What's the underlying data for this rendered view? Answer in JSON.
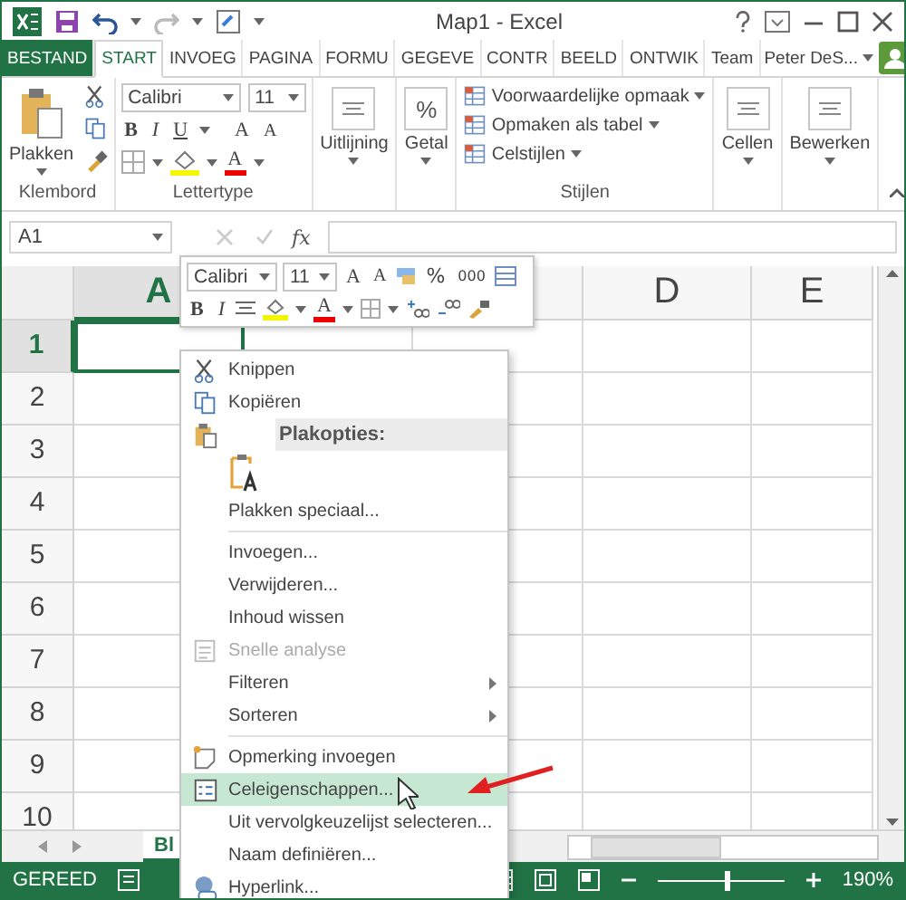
{
  "window": {
    "title": "Map1 - Excel"
  },
  "tabs": [
    {
      "label": "BESTAND",
      "kind": "file",
      "selected": false
    },
    {
      "label": "START",
      "kind": "tab",
      "selected": true
    },
    {
      "label": "INVOEG",
      "kind": "tab",
      "selected": false
    },
    {
      "label": "PAGINA",
      "kind": "tab",
      "selected": false
    },
    {
      "label": "FORMU",
      "kind": "tab",
      "selected": false
    },
    {
      "label": "GEGEVE",
      "kind": "tab",
      "selected": false
    },
    {
      "label": "CONTR",
      "kind": "tab",
      "selected": false
    },
    {
      "label": "BEELD",
      "kind": "tab",
      "selected": false
    },
    {
      "label": "ONTWIK",
      "kind": "tab",
      "selected": false
    },
    {
      "label": "Team",
      "kind": "tab",
      "selected": false
    }
  ],
  "account": {
    "name": "Peter DeS..."
  },
  "ribbon": {
    "groups": [
      {
        "kind": "clipboard",
        "name": "Klembord",
        "label": "Plakken"
      },
      {
        "kind": "font",
        "name": "Lettertype",
        "font": "Calibri",
        "size": "11",
        "bold": "B",
        "italic": "I",
        "underline": "U",
        "grow": "A",
        "shrink": "A",
        "font_color": "A"
      },
      {
        "kind": "big",
        "label": "Uitlijning"
      },
      {
        "kind": "big",
        "label": "Getal",
        "glyph": "%"
      },
      {
        "kind": "styles",
        "name": "Stijlen",
        "items": [
          "Voorwaardelijke opmaak",
          "Opmaken als tabel",
          "Celstijlen"
        ]
      },
      {
        "kind": "big",
        "label": "Cellen"
      },
      {
        "kind": "big",
        "label": "Bewerken"
      }
    ]
  },
  "formula_bar": {
    "name_box": "A1",
    "function_label": "fx"
  },
  "grid": {
    "columns": [
      {
        "label": "A",
        "selected": true
      },
      {
        "label": "D",
        "selected": false
      },
      {
        "label": "E",
        "selected": false
      }
    ],
    "rows": [
      {
        "label": "1",
        "selected": true
      },
      {
        "label": "2",
        "selected": false
      },
      {
        "label": "3",
        "selected": false
      },
      {
        "label": "4",
        "selected": false
      },
      {
        "label": "5",
        "selected": false
      },
      {
        "label": "6",
        "selected": false
      },
      {
        "label": "7",
        "selected": false
      },
      {
        "label": "8",
        "selected": false
      },
      {
        "label": "9",
        "selected": false
      },
      {
        "label": "10",
        "selected": false
      }
    ]
  },
  "mini_toolbar": {
    "font": "Calibri",
    "size": "11",
    "grow": "A",
    "shrink": "A",
    "percent": "%",
    "thousands": "000",
    "bold": "B",
    "italic": "I",
    "font_color": "A"
  },
  "context_menu": {
    "items": [
      {
        "kind": "item",
        "label": "Knippen",
        "disabled": false,
        "submenu": false,
        "selected": false
      },
      {
        "kind": "item",
        "label": "Kopiëren",
        "disabled": false,
        "submenu": false,
        "selected": false
      },
      {
        "kind": "header",
        "label": "Plakopties:"
      },
      {
        "kind": "paste"
      },
      {
        "kind": "item",
        "label": "Plakken speciaal...",
        "disabled": false,
        "submenu": false,
        "selected": false
      },
      {
        "kind": "separator"
      },
      {
        "kind": "item",
        "label": "Invoegen...",
        "disabled": false,
        "submenu": false,
        "selected": false
      },
      {
        "kind": "item",
        "label": "Verwijderen...",
        "disabled": false,
        "submenu": false,
        "selected": false
      },
      {
        "kind": "item",
        "label": "Inhoud wissen",
        "disabled": false,
        "submenu": false,
        "selected": false
      },
      {
        "kind": "item",
        "label": "Snelle analyse",
        "disabled": true,
        "submenu": false,
        "selected": false
      },
      {
        "kind": "item",
        "label": "Filteren",
        "disabled": false,
        "submenu": true,
        "selected": false
      },
      {
        "kind": "item",
        "label": "Sorteren",
        "disabled": false,
        "submenu": true,
        "selected": false
      },
      {
        "kind": "separator"
      },
      {
        "kind": "item",
        "label": "Opmerking invoegen",
        "disabled": false,
        "submenu": false,
        "selected": false
      },
      {
        "kind": "item",
        "label": "Celeigenschappen...",
        "disabled": false,
        "submenu": false,
        "selected": true
      },
      {
        "kind": "item",
        "label": "Uit vervolgkeuzelijst selecteren...",
        "disabled": false,
        "submenu": false,
        "selected": false
      },
      {
        "kind": "item",
        "label": "Naam definiëren...",
        "disabled": false,
        "submenu": false,
        "selected": false
      },
      {
        "kind": "item",
        "label": "Hyperlink...",
        "disabled": false,
        "submenu": false,
        "selected": false
      }
    ]
  },
  "sheet_tabs": [
    {
      "label": "Bl",
      "selected": true
    }
  ],
  "status_bar": {
    "status": "GEREED",
    "zoom": "190%",
    "zoom_slider": {
      "level": 0.55
    }
  }
}
